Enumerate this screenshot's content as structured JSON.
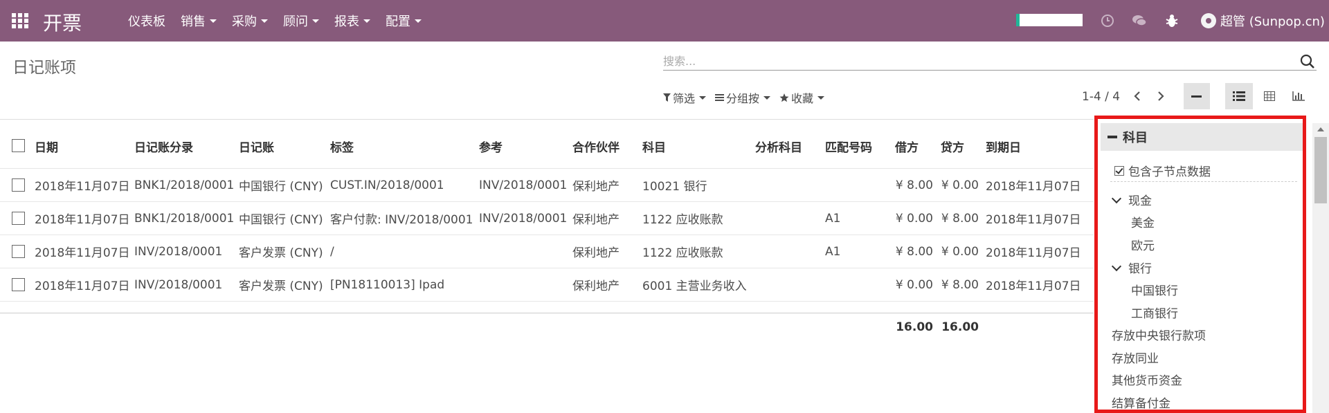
{
  "navbar": {
    "app_title": "开票",
    "menu": [
      {
        "label": "仪表板",
        "has_caret": false
      },
      {
        "label": "销售",
        "has_caret": true
      },
      {
        "label": "采购",
        "has_caret": true
      },
      {
        "label": "顾问",
        "has_caret": true
      },
      {
        "label": "报表",
        "has_caret": true
      },
      {
        "label": "配置",
        "has_caret": true
      }
    ],
    "user_label": "超管 (Sunpop.cn)",
    "icons": [
      "apps-grid-icon",
      "clock-icon",
      "chat-icon",
      "bug-icon",
      "avatar-icon"
    ],
    "colors": {
      "brand": "#875a7b",
      "progress_accent": "#21b799"
    }
  },
  "control_panel": {
    "breadcrumb": "日记账项",
    "search_placeholder": "搜索...",
    "filters_label": "筛选",
    "groupby_label": "分组按",
    "favorites_label": "收藏",
    "pager": "1-4 / 4"
  },
  "table": {
    "columns": [
      "日期",
      "日记账分录",
      "日记账",
      "标签",
      "参考",
      "合作伙伴",
      "科目",
      "分析科目",
      "匹配号码",
      "借方",
      "贷方",
      "到期日"
    ],
    "rows": [
      [
        "2018年11月07日",
        "BNK1/2018/0001",
        "中国银行 (CNY)",
        "CUST.IN/2018/0001",
        "INV/2018/0001",
        "保利地产",
        "10021 银行",
        "",
        "",
        "¥ 8.00",
        "¥ 0.00",
        "2018年11月07日"
      ],
      [
        "2018年11月07日",
        "BNK1/2018/0001",
        "中国银行 (CNY)",
        "客户付款: INV/2018/0001",
        "INV/2018/0001",
        "保利地产",
        "1122 应收账款",
        "",
        "A1",
        "¥ 0.00",
        "¥ 8.00",
        "2018年11月07日"
      ],
      [
        "2018年11月07日",
        "INV/2018/0001",
        "客户发票 (CNY)",
        "/",
        "",
        "保利地产",
        "1122 应收账款",
        "",
        "A1",
        "¥ 8.00",
        "¥ 0.00",
        "2018年11月07日"
      ],
      [
        "2018年11月07日",
        "INV/2018/0001",
        "客户发票 (CNY)",
        "[PN18110013] Ipad",
        "",
        "保利地产",
        "6001 主营业务收入",
        "",
        "",
        "¥ 0.00",
        "¥ 8.00",
        "2018年11月07日"
      ]
    ],
    "totals": {
      "debit": "16.00",
      "credit": "16.00"
    }
  },
  "search_panel": {
    "title": "科目",
    "include_children_label": "包含子节点数据",
    "items": [
      {
        "label": "现金",
        "expanded": true,
        "level": 0
      },
      {
        "label": "美金",
        "level": 1
      },
      {
        "label": "欧元",
        "level": 1
      },
      {
        "label": "银行",
        "expanded": true,
        "level": 0
      },
      {
        "label": "中国银行",
        "level": 1
      },
      {
        "label": "工商银行",
        "level": 1
      },
      {
        "label": "存放中央银行款项",
        "level": 0
      },
      {
        "label": "存放同业",
        "level": 0
      },
      {
        "label": "其他货币资金",
        "level": 0
      },
      {
        "label": "结算备付金",
        "level": 0
      }
    ],
    "highlight_color": "#e81919"
  }
}
